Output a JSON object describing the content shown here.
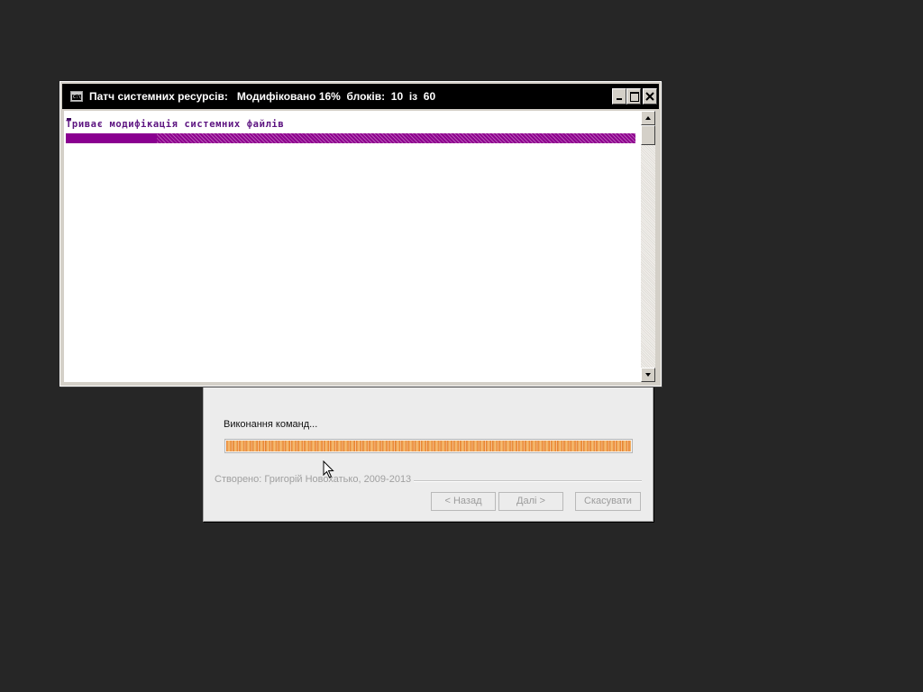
{
  "console_window": {
    "icon_label": "C:\\",
    "title": "Патч системних ресурсів:   Модифіковано 16%  блоків:  10  із  60",
    "message": "Триває модифікація системних файлів",
    "progress_fraction": 0.16
  },
  "installer_dialog": {
    "status_text": "Виконання команд...",
    "progress_fraction": 1.0,
    "credits": "Створено: Григорій Новохатько, 2009-2013",
    "buttons": {
      "back": "< Назад",
      "next": "Далі >",
      "cancel": "Скасувати"
    }
  },
  "colors": {
    "desktop_background": "#262626",
    "console_text": "#5c1380",
    "console_progress": "#8a0090",
    "installer_progress": "#f1a04a"
  }
}
